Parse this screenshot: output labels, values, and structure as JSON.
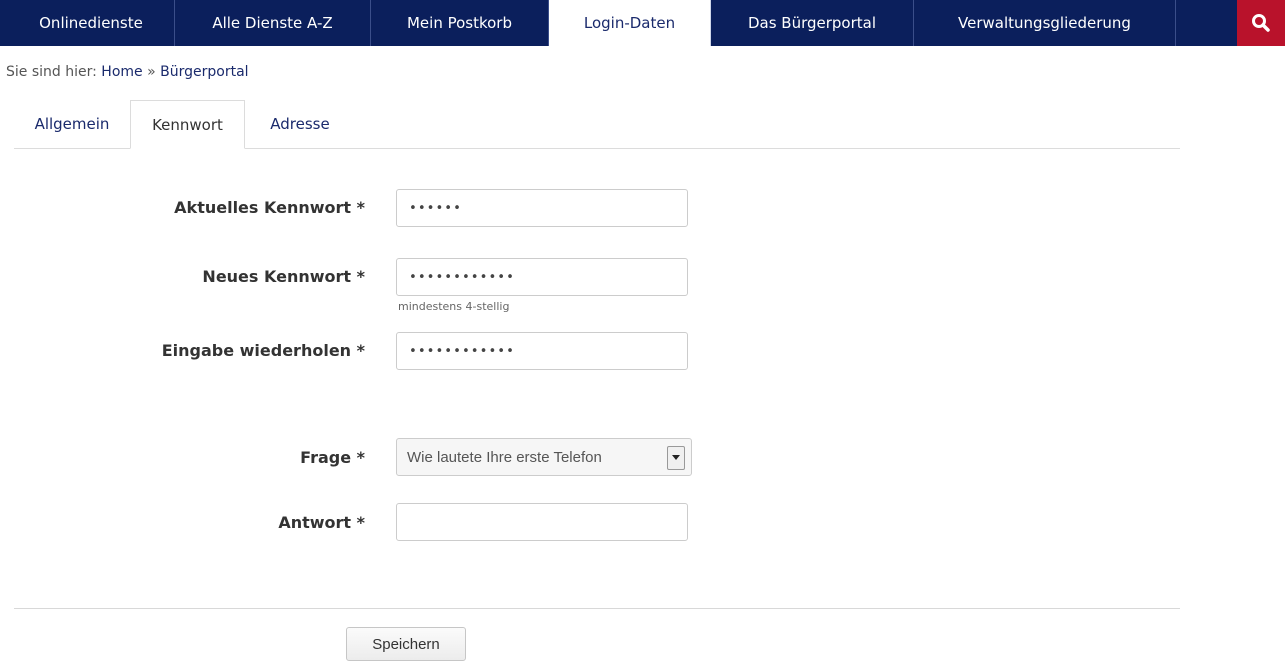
{
  "nav": {
    "items": [
      {
        "label": "Onlinedienste",
        "active": false
      },
      {
        "label": "Alle Dienste A-Z",
        "active": false
      },
      {
        "label": "Mein Postkorb",
        "active": false
      },
      {
        "label": "Login-Daten",
        "active": true
      },
      {
        "label": "Das Bürgerportal",
        "active": false
      },
      {
        "label": "Verwaltungsgliederung",
        "active": false
      }
    ],
    "search_icon": "search-icon",
    "colors": {
      "bar": "#0b1f5c",
      "search": "#b9122b"
    }
  },
  "breadcrumb": {
    "prefix": "Sie sind hier:",
    "home": "Home",
    "separator": "»",
    "current": "Bürgerportal"
  },
  "tabs": [
    {
      "label": "Allgemein",
      "active": false
    },
    {
      "label": "Kennwort",
      "active": true
    },
    {
      "label": "Adresse",
      "active": false
    }
  ],
  "form": {
    "current_password": {
      "label": "Aktuelles Kennwort *",
      "value": "••••••"
    },
    "new_password": {
      "label": "Neues Kennwort *",
      "value": "••••••••••••",
      "hint": "mindestens 4-stellig"
    },
    "repeat_password": {
      "label": "Eingabe wiederholen *",
      "value": "••••••••••••"
    },
    "question": {
      "label": "Frage *",
      "selected": "Wie lautete Ihre erste Telefon"
    },
    "answer": {
      "label": "Antwort *",
      "value": ""
    },
    "save_label": "Speichern"
  }
}
